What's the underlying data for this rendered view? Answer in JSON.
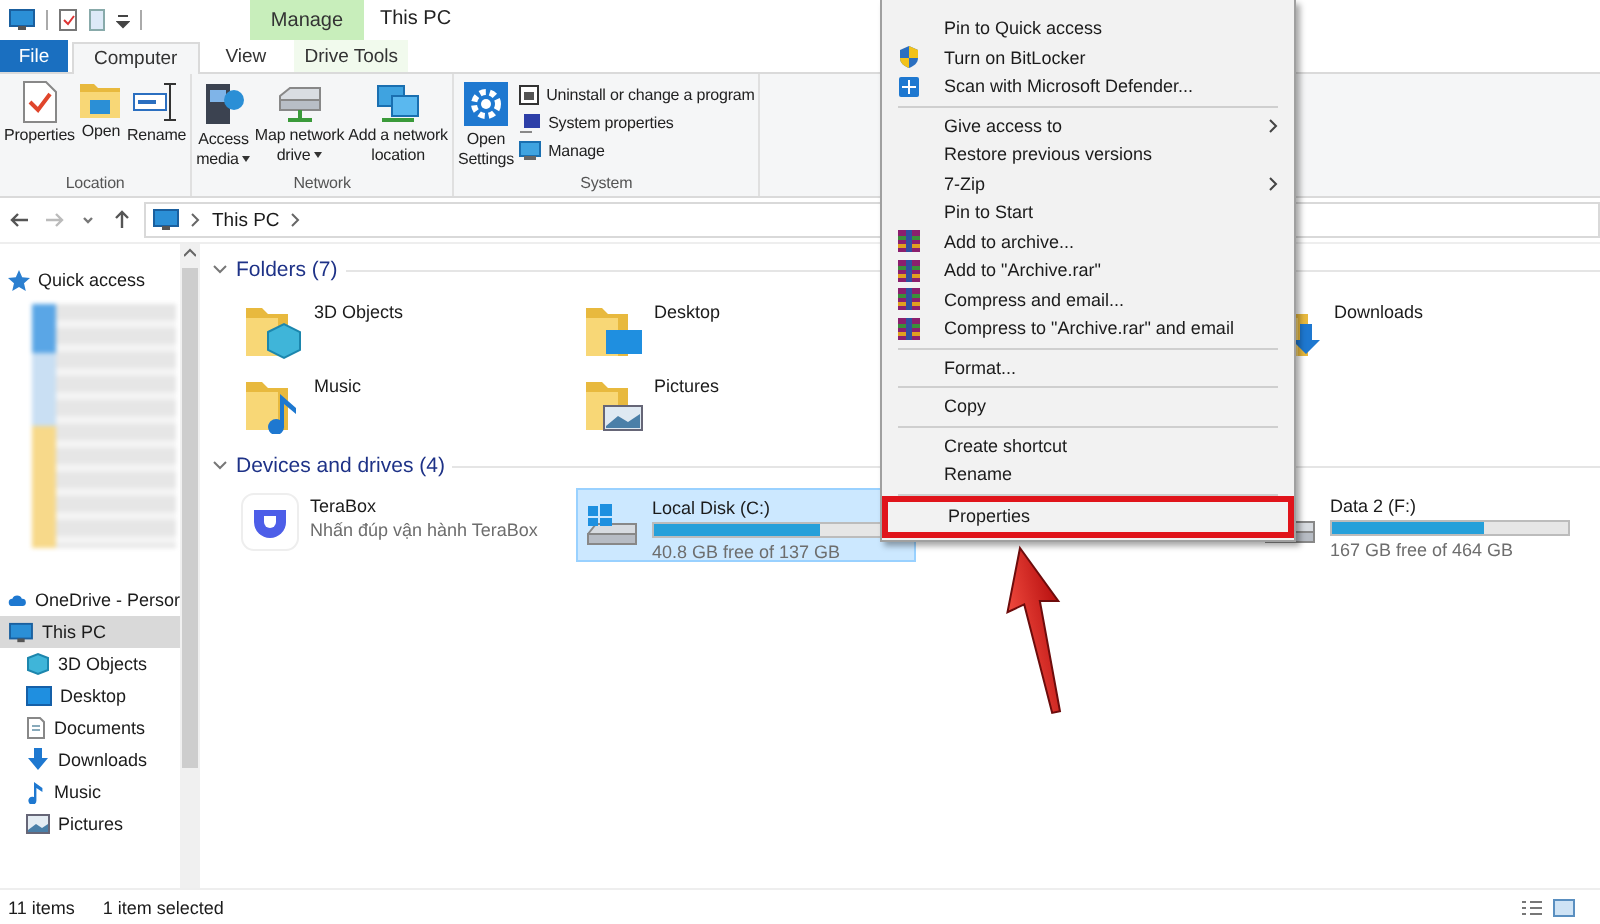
{
  "title_bar": {
    "title": "This PC",
    "contextual_tab": "Manage"
  },
  "ribbon_tabs": [
    {
      "label": "File",
      "kind": "file",
      "selected": false
    },
    {
      "label": "Computer",
      "kind": "tab",
      "selected": true
    },
    {
      "label": "View",
      "kind": "tab",
      "selected": false
    },
    {
      "label": "Drive Tools",
      "kind": "contextual",
      "selected": false
    }
  ],
  "ribbon_groups": [
    {
      "label": "Location",
      "buttons": [
        {
          "label": "Properties",
          "kind": "large",
          "dropdown": false
        },
        {
          "label": "Open",
          "kind": "large",
          "dropdown": false
        },
        {
          "label": "Rename",
          "kind": "large",
          "dropdown": false
        }
      ]
    },
    {
      "label": "Network",
      "buttons": [
        {
          "label": "Access media",
          "kind": "large",
          "dropdown": true
        },
        {
          "label": "Map network drive",
          "kind": "large",
          "dropdown": true
        },
        {
          "label": "Add a network location",
          "kind": "large",
          "dropdown": false
        }
      ]
    },
    {
      "label": "System",
      "buttons": [
        {
          "label": "Open Settings",
          "kind": "large",
          "dropdown": false
        },
        {
          "label": "Uninstall or change a program",
          "kind": "small",
          "dropdown": false
        },
        {
          "label": "System properties",
          "kind": "small",
          "dropdown": false
        },
        {
          "label": "Manage",
          "kind": "small",
          "dropdown": false
        }
      ]
    }
  ],
  "address_bar": {
    "breadcrumb": [
      "This PC"
    ]
  },
  "sidebar": {
    "items": [
      {
        "kind": "link",
        "label": "Quick access",
        "selected": false
      },
      {
        "kind": "blurred"
      },
      {
        "kind": "link",
        "label": "OneDrive - Persor",
        "selected": false
      },
      {
        "kind": "link",
        "label": "This PC",
        "selected": true,
        "children": [
          {
            "kind": "link",
            "label": "3D Objects",
            "selected": false
          },
          {
            "kind": "link",
            "label": "Desktop",
            "selected": false
          },
          {
            "kind": "link",
            "label": "Documents",
            "selected": false
          },
          {
            "kind": "link",
            "label": "Downloads",
            "selected": false
          },
          {
            "kind": "link",
            "label": "Music",
            "selected": false
          },
          {
            "kind": "link",
            "label": "Pictures",
            "selected": false
          }
        ]
      }
    ]
  },
  "sections": [
    {
      "title": "Folders (7)",
      "expanded": true,
      "items": [
        {
          "kind": "folder",
          "label": "3D Objects",
          "selected": false
        },
        {
          "kind": "folder",
          "label": "Desktop",
          "selected": false
        },
        {
          "kind": "folder",
          "label": "Downloads",
          "selected": false
        },
        {
          "kind": "folder",
          "label": "Music",
          "selected": false
        },
        {
          "kind": "folder",
          "label": "Pictures",
          "selected": false
        }
      ]
    },
    {
      "title": "Devices and drives (4)",
      "expanded": true,
      "items": [
        {
          "kind": "app",
          "label": "TeraBox",
          "detail": "Nhấn đúp vận hành TeraBox",
          "selected": false
        },
        {
          "kind": "drive",
          "label": "Local Disk (C:)",
          "level": 0.7,
          "detail": "40.8 GB free of 137 GB",
          "selected": true
        },
        {
          "kind": "drive",
          "label": "Data 2 (F:)",
          "level": 0.64,
          "detail": "167 GB free of 464 GB",
          "selected": false
        }
      ]
    }
  ],
  "context_menu": {
    "items": [
      {
        "kind": "item",
        "label": "Pin to Quick access",
        "submenu": false,
        "highlighted": false
      },
      {
        "kind": "item",
        "label": "Turn on BitLocker",
        "submenu": false,
        "highlighted": false
      },
      {
        "kind": "item",
        "label": "Scan with Microsoft Defender...",
        "submenu": false,
        "highlighted": false
      },
      {
        "kind": "separator"
      },
      {
        "kind": "item",
        "label": "Give access to",
        "submenu": true,
        "highlighted": false
      },
      {
        "kind": "item",
        "label": "Restore previous versions",
        "submenu": false,
        "highlighted": false
      },
      {
        "kind": "item",
        "label": "7-Zip",
        "submenu": true,
        "highlighted": false
      },
      {
        "kind": "item",
        "label": "Pin to Start",
        "submenu": false,
        "highlighted": false
      },
      {
        "kind": "item",
        "label": "Add to archive...",
        "submenu": false,
        "highlighted": false
      },
      {
        "kind": "item",
        "label": "Add to \"Archive.rar\"",
        "submenu": false,
        "highlighted": false
      },
      {
        "kind": "item",
        "label": "Compress and email...",
        "submenu": false,
        "highlighted": false
      },
      {
        "kind": "item",
        "label": "Compress to \"Archive.rar\" and email",
        "submenu": false,
        "highlighted": false
      },
      {
        "kind": "separator"
      },
      {
        "kind": "item",
        "label": "Format...",
        "submenu": false,
        "highlighted": false
      },
      {
        "kind": "separator"
      },
      {
        "kind": "item",
        "label": "Copy",
        "submenu": false,
        "highlighted": false
      },
      {
        "kind": "separator"
      },
      {
        "kind": "item",
        "label": "Create shortcut",
        "submenu": false,
        "highlighted": false
      },
      {
        "kind": "item",
        "label": "Rename",
        "submenu": false,
        "highlighted": false
      },
      {
        "kind": "separator"
      },
      {
        "kind": "item",
        "label": "Properties",
        "submenu": false,
        "highlighted": true
      }
    ]
  },
  "status_bar": {
    "item_count": "11 items",
    "selection": "1 item selected"
  }
}
